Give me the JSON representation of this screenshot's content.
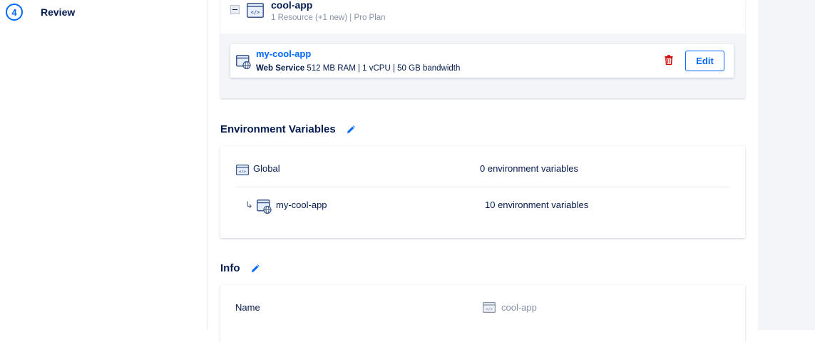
{
  "sidebar": {
    "step_number": "4",
    "step_label": "Review"
  },
  "app": {
    "name": "cool-app",
    "meta": "1 Resource (+1 new) | Pro Plan",
    "component": {
      "name": "my-cool-app",
      "type": "Web Service",
      "specs": "512 MB RAM | 1 vCPU | 50 GB bandwidth",
      "edit_label": "Edit"
    }
  },
  "env_vars": {
    "title": "Environment Variables",
    "rows": [
      {
        "name": "Global",
        "value": "0 environment variables"
      },
      {
        "name": "my-cool-app",
        "value": "10 environment variables",
        "prefix": "↳"
      }
    ]
  },
  "info": {
    "title": "Info",
    "rows": [
      {
        "label": "Name",
        "value": "cool-app"
      }
    ]
  },
  "colors": {
    "accent": "#0069ff",
    "text": "#031b4e",
    "muted": "#8592a6",
    "danger": "#d10000",
    "panel_bg": "#f3f5f9"
  },
  "icons": [
    "code-window-icon",
    "web-globe-window-icon",
    "trash-icon",
    "pencil-icon",
    "subitem-arrow-icon"
  ]
}
